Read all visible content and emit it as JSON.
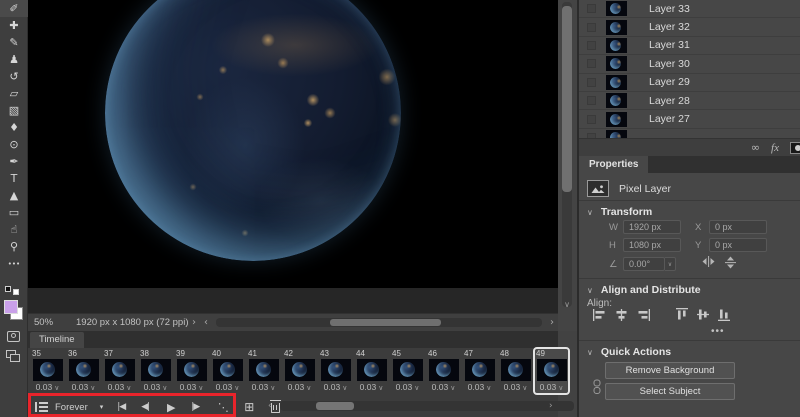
{
  "colors": {
    "annotation_red": "#e9242b",
    "foreground_swatch": "#c9a0e9",
    "background_swatch": "#ffffff"
  },
  "toolbar": {
    "tools": [
      {
        "name": "eyedropper-tool-icon",
        "glyph": "✐"
      },
      {
        "name": "spot-healing-brush-tool-icon",
        "glyph": "✚"
      },
      {
        "name": "brush-tool-icon",
        "glyph": "✎"
      },
      {
        "name": "clone-stamp-tool-icon",
        "glyph": "♟"
      },
      {
        "name": "history-brush-tool-icon",
        "glyph": "↺"
      },
      {
        "name": "eraser-tool-icon",
        "glyph": "▱"
      },
      {
        "name": "gradient-tool-icon",
        "glyph": "▧"
      },
      {
        "name": "blur-tool-icon",
        "glyph": "♦"
      },
      {
        "name": "dodge-tool-icon",
        "glyph": "⊙"
      },
      {
        "name": "pen-tool-icon",
        "glyph": "✒"
      },
      {
        "name": "type-tool-icon",
        "glyph": "T"
      },
      {
        "name": "path-selection-tool-icon",
        "glyph": "▲"
      },
      {
        "name": "rectangle-tool-icon",
        "glyph": "▭"
      },
      {
        "name": "hand-tool-icon",
        "glyph": "☝"
      },
      {
        "name": "zoom-tool-icon",
        "glyph": "⚲"
      },
      {
        "name": "edit-toolbar-icon",
        "glyph": "•••"
      }
    ]
  },
  "statusbar": {
    "zoom_level": "50%",
    "doc_info": "1920 px x 1080 px (72 ppi)",
    "expand_arrow": "›",
    "scroll_left_arrow": "‹",
    "scroll_right_arrow": "›",
    "scroll_down_arrow": "∨"
  },
  "timeline": {
    "tab_label": "Timeline",
    "loop_label": "Forever",
    "loop_dropdown_glyph": "▾",
    "delay_dropdown_glyph": "∨",
    "controls": {
      "first_frame_glyph": "|◀",
      "prev_frame_glyph": "◀|",
      "play_glyph": "▶",
      "next_frame_glyph": "|▶",
      "tween_glyph": "⋱",
      "duplicate_glyph": "⊞"
    },
    "scroll_left_arrow": "‹",
    "scroll_right_arrow": "›",
    "frames": [
      {
        "number": "35",
        "delay": "0.03",
        "selected": false
      },
      {
        "number": "36",
        "delay": "0.03",
        "selected": false
      },
      {
        "number": "37",
        "delay": "0.03",
        "selected": false
      },
      {
        "number": "38",
        "delay": "0.03",
        "selected": false
      },
      {
        "number": "39",
        "delay": "0.03",
        "selected": false
      },
      {
        "number": "40",
        "delay": "0.03",
        "selected": false
      },
      {
        "number": "41",
        "delay": "0.03",
        "selected": false
      },
      {
        "number": "42",
        "delay": "0.03",
        "selected": false
      },
      {
        "number": "43",
        "delay": "0.03",
        "selected": false
      },
      {
        "number": "44",
        "delay": "0.03",
        "selected": false
      },
      {
        "number": "45",
        "delay": "0.03",
        "selected": false
      },
      {
        "number": "46",
        "delay": "0.03",
        "selected": false
      },
      {
        "number": "47",
        "delay": "0.03",
        "selected": false
      },
      {
        "number": "48",
        "delay": "0.03",
        "selected": false
      },
      {
        "number": "49",
        "delay": "0.03",
        "selected": true
      }
    ]
  },
  "layers_panel": {
    "items": [
      "Layer 33",
      "Layer 32",
      "Layer 31",
      "Layer 30",
      "Layer 29",
      "Layer 28",
      "Layer 27"
    ],
    "footer": {
      "link_glyph": "∞",
      "fx_label": "fx"
    }
  },
  "properties": {
    "tab_label": "Properties",
    "layer_type": "Pixel Layer",
    "transform": {
      "section_label": "Transform",
      "chevron_glyph": "∨",
      "w_label": "W",
      "w_value": "1920 px",
      "h_label": "H",
      "h_value": "1080 px",
      "x_label": "X",
      "x_value": "0 px",
      "y_label": "Y",
      "y_value": "0 px",
      "angle_glyph": "∠",
      "angle_value": "0.00°",
      "angle_dropdown_glyph": "∨"
    },
    "align": {
      "section_label": "Align and Distribute",
      "chevron_glyph": "∨",
      "align_label": "Align:",
      "more_label": "•••"
    },
    "quick_actions": {
      "section_label": "Quick Actions",
      "chevron_glyph": "∨",
      "buttons": [
        "Remove Background",
        "Select Subject"
      ]
    }
  }
}
